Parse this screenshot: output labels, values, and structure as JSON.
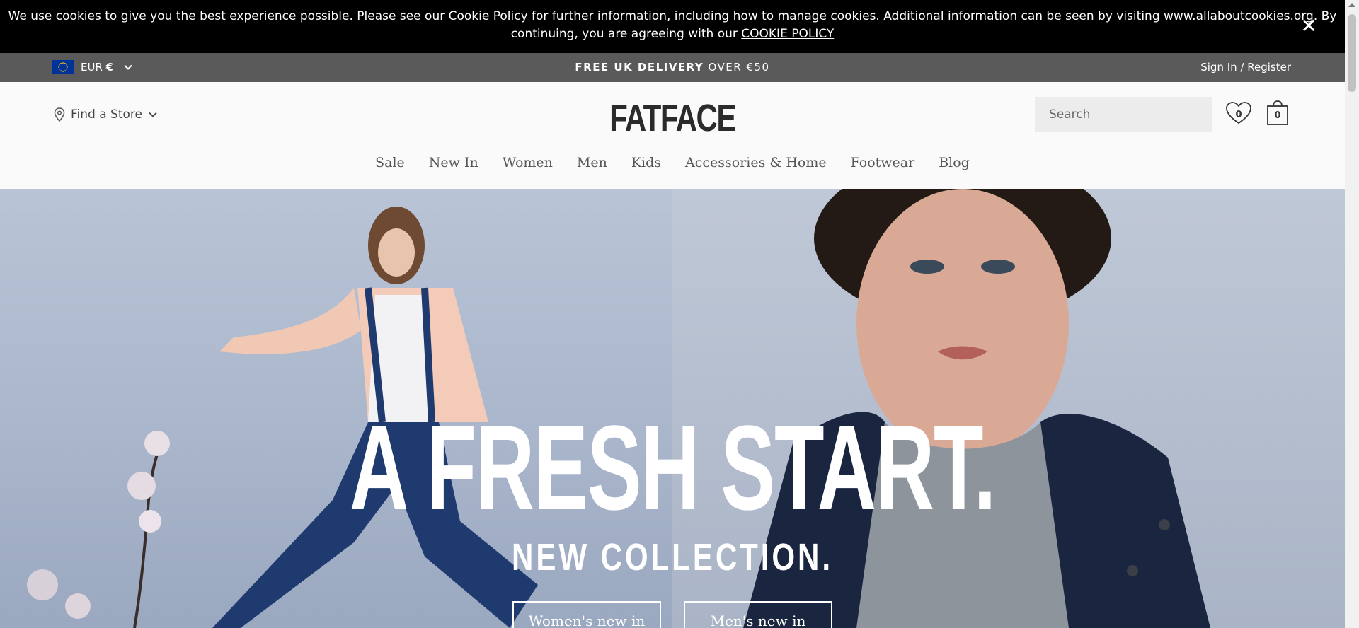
{
  "cookie_banner": {
    "text_1": "We use cookies to give you the best experience possible. Please see our ",
    "cookie_policy_link": "Cookie Policy",
    "text_2": " for further information, including how to manage cookies. Additional information can be seen by visiting ",
    "allaboutcookies_link": "www.allaboutcookies.org",
    "text_3": ". By continuing, you are agreeing with our ",
    "cookie_policy_caps_link": "COOKIE POLICY",
    "close_label": "✕"
  },
  "utility_bar": {
    "currency_code": "EUR",
    "currency_symbol": "€",
    "promo_bold": "FREE UK DELIVERY",
    "promo_rest": "OVER €50",
    "signin_label": "Sign In / Register"
  },
  "header": {
    "find_store_label": "Find a Store",
    "logo_text": "FATFACE",
    "search_placeholder": "Search",
    "wishlist_count": "0",
    "basket_count": "0"
  },
  "nav": {
    "items": [
      "Sale",
      "New In",
      "Women",
      "Men",
      "Kids",
      "Accessories & Home",
      "Footwear",
      "Blog"
    ]
  },
  "hero": {
    "title": "A FRESH START.",
    "subtitle": "NEW COLLECTION.",
    "women_button": "Women's new in",
    "men_button": "Men's new in"
  },
  "icons": {
    "close": "close-icon",
    "flag": "eu-flag-icon",
    "chevron": "chevron-down-icon",
    "location": "location-pin-icon",
    "search": "search-icon",
    "wishlist": "heart-icon",
    "basket": "shopping-bag-icon"
  },
  "colors": {
    "cookie_bg": "#000000",
    "utility_bg": "#5a5a5a",
    "header_bg": "#fafafa",
    "logo": "#2b2b2b"
  }
}
